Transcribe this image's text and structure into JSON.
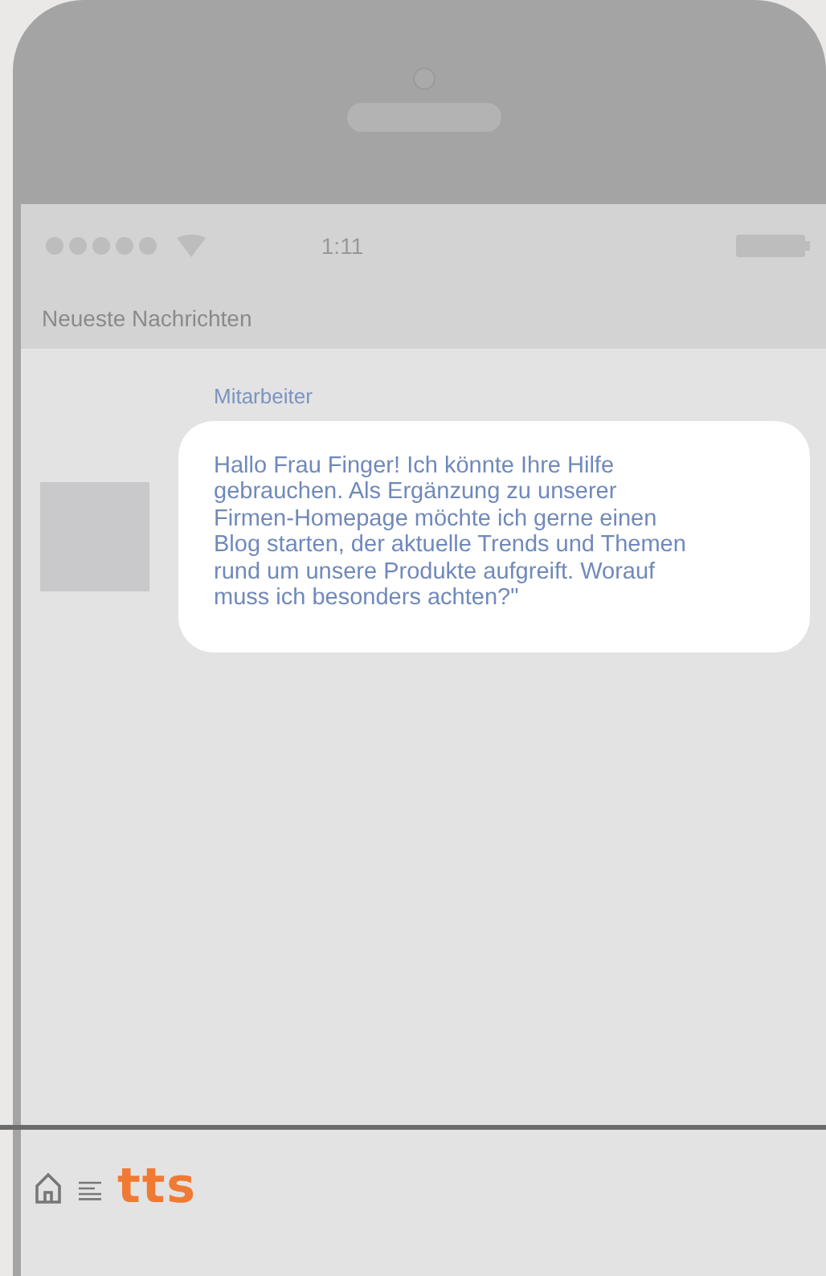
{
  "status_bar": {
    "time": "1:11"
  },
  "header": {
    "title": "Neueste Nachrichten"
  },
  "messages": [
    {
      "sender": "Mitarbeiter",
      "text": "Hallo Frau Finger! Ich könnte Ihre Hilfe gebrauchen. Als Ergänzung zu unserer Firmen-Homepage möchte ich gerne einen Blog starten, der aktuelle Trends und Themen rund um unsere Produkte aufgreift. Worauf muss ich besonders achten?\""
    }
  ],
  "footer": {
    "logo": "tts"
  }
}
